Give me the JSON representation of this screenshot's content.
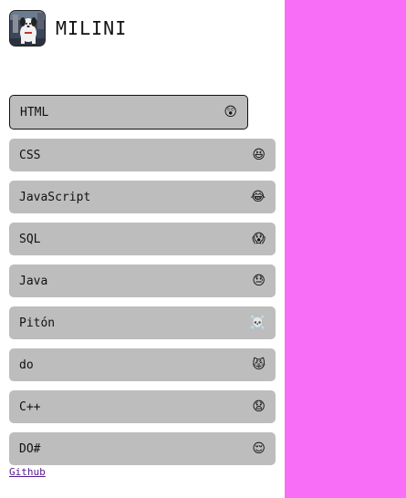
{
  "theme": {
    "accent": "#f96ef7",
    "item_bg": "#bdbdbd"
  },
  "header": {
    "brand": "MILINI",
    "avatar_icon": "cartoon-dog-avatar"
  },
  "languages": [
    {
      "label": "HTML",
      "emoji": "😲",
      "active": true
    },
    {
      "label": "CSS",
      "emoji": "😆",
      "active": false
    },
    {
      "label": "JavaScript",
      "emoji": "😂",
      "active": false
    },
    {
      "label": "SQL",
      "emoji": "😱",
      "active": false
    },
    {
      "label": "Java",
      "emoji": "😓",
      "active": false
    },
    {
      "label": "Pitón",
      "emoji": "☠️",
      "active": false
    },
    {
      "label": "do",
      "emoji": "😾",
      "active": false
    },
    {
      "label": "C++",
      "emoji": "😧",
      "active": false
    },
    {
      "label": "DO#",
      "emoji": "😌",
      "active": false
    }
  ],
  "footer": {
    "link_label": "Github"
  }
}
